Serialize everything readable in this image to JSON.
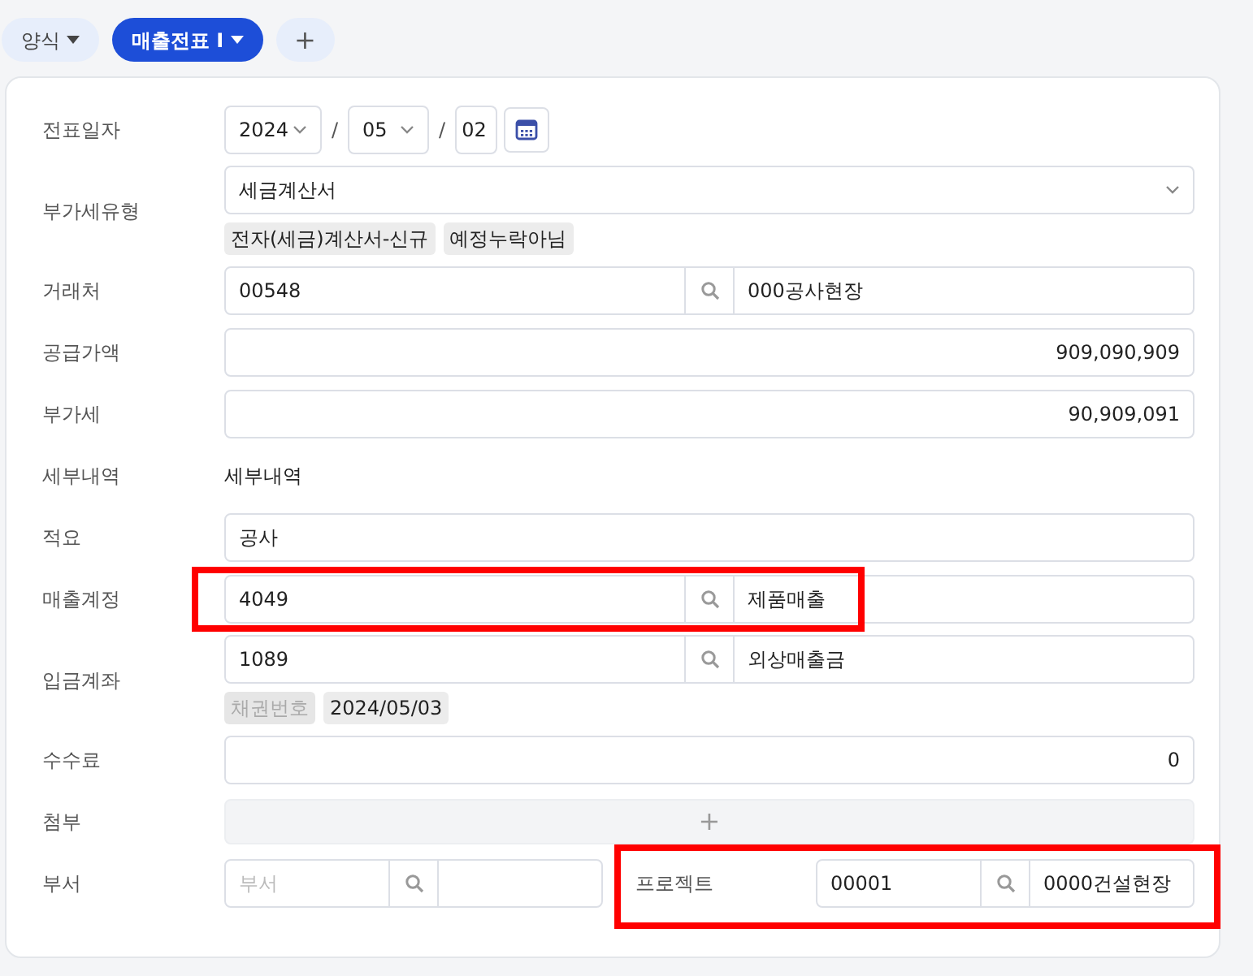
{
  "tabs": [
    {
      "label": "양식",
      "kind": "dropdown",
      "selected": false
    },
    {
      "label": "매출전표 I",
      "kind": "dropdown",
      "selected": true
    },
    {
      "label": "+",
      "kind": "add",
      "selected": false
    }
  ],
  "rows": [
    {
      "kind": "date",
      "label": "전표일자",
      "year": "2024",
      "separators": [
        "/",
        "/"
      ],
      "month": "05",
      "day": "02"
    },
    {
      "kind": "select",
      "label": "부가세유형",
      "value": "세금계산서",
      "tags": [
        {
          "text": "전자(세금)계산서-신규",
          "disabled": false
        },
        {
          "text": "예정누락아님",
          "disabled": false
        }
      ]
    },
    {
      "kind": "lookup",
      "label": "거래처",
      "code": "00548",
      "name": "000공사현장",
      "highlighted": false
    },
    {
      "kind": "amount",
      "label": "공급가액",
      "value": "909,090,909"
    },
    {
      "kind": "amount",
      "label": "부가세",
      "value": "90,909,091"
    },
    {
      "kind": "text",
      "label": "세부내역",
      "value": "세부내역"
    },
    {
      "kind": "input",
      "label": "적요",
      "value": "공사"
    },
    {
      "kind": "lookup",
      "label": "매출계정",
      "code": "4049",
      "name": "제품매출",
      "highlighted": true
    },
    {
      "kind": "lookup",
      "label": "입금계좌",
      "code": "1089",
      "name": "외상매출금",
      "highlighted": false,
      "tags": [
        {
          "text": "채권번호",
          "disabled": true
        },
        {
          "text": "2024/05/03",
          "disabled": false
        }
      ]
    },
    {
      "kind": "amount",
      "label": "수수료",
      "value": "0"
    },
    {
      "kind": "attachment",
      "label": "첨부",
      "button": "+"
    },
    {
      "kind": "split",
      "label": "부서",
      "placeholder": "부서",
      "project": {
        "label": "프로젝트",
        "code": "00001",
        "name": "0000건설현장",
        "highlighted": true
      }
    }
  ]
}
